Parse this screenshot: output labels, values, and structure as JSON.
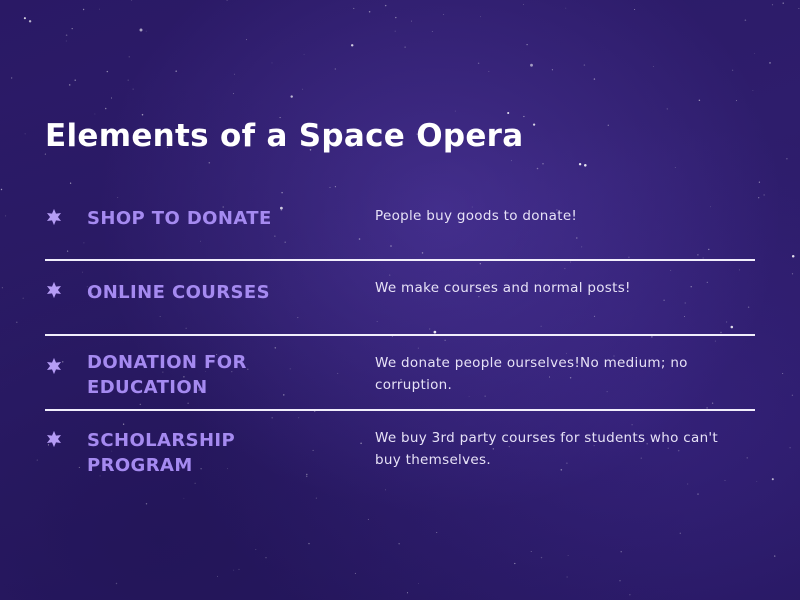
{
  "title": "Elements of a Space Opera",
  "colors": {
    "background": "#2b1a66",
    "heading": "#a58af0",
    "accent_icon": "#b59cf5",
    "text": "#e7e2f7",
    "divider": "#f1eefc"
  },
  "items": [
    {
      "icon": "star-burst-icon",
      "heading": "SHOP TO DONATE",
      "description": "People buy goods to donate!"
    },
    {
      "icon": "star-burst-icon",
      "heading": "ONLINE COURSES",
      "description": "We make courses and normal posts!"
    },
    {
      "icon": "star-burst-icon",
      "heading": "DONATION FOR EDUCATION",
      "description": "We donate people ourselves!No medium; no corruption."
    },
    {
      "icon": "star-burst-icon",
      "heading": "SCHOLARSHIP PROGRAM",
      "description": "We buy 3rd party courses for students who can't buy themselves."
    }
  ]
}
